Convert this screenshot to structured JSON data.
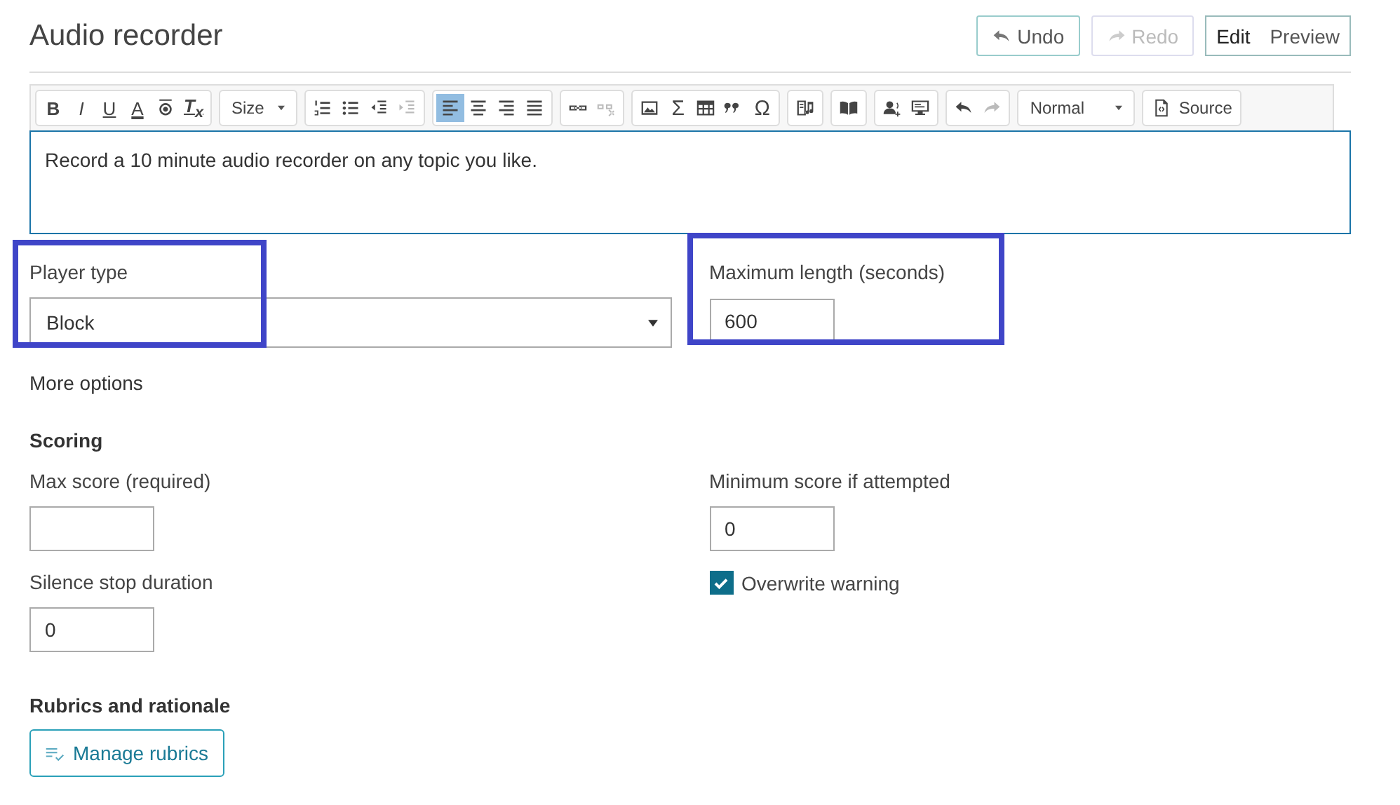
{
  "header": {
    "title": "Audio recorder",
    "undo": {
      "label": "Undo",
      "disabled": false
    },
    "redo": {
      "label": "Redo",
      "disabled": true
    },
    "modes": [
      {
        "label": "Edit",
        "selected": true
      },
      {
        "label": "Preview",
        "selected": false
      }
    ]
  },
  "toolbar": {
    "groups": [
      [
        {
          "kind": "text",
          "label": "B",
          "disabled": false,
          "active": false
        },
        {
          "kind": "text",
          "label": "I",
          "disabled": false,
          "active": false
        },
        {
          "kind": "text",
          "label": "U",
          "disabled": false,
          "active": false
        },
        {
          "kind": "text",
          "label": "A",
          "disabled": false,
          "active": false
        },
        {
          "kind": "format-circle",
          "disabled": false,
          "active": false
        },
        {
          "kind": "text",
          "label": "T$_{x}$",
          "disabled": false,
          "active": false
        }
      ],
      [
        {
          "kind": "dropdown",
          "label": "Size",
          "disabled": false,
          "active": false
        }
      ],
      [
        {
          "kind": "numbered-list",
          "disabled": false,
          "active": false
        },
        {
          "kind": "bullet-list",
          "disabled": false,
          "active": false
        },
        {
          "kind": "outdent",
          "disabled": false,
          "active": false
        },
        {
          "kind": "indent",
          "disabled": true,
          "active": false
        }
      ],
      [
        {
          "kind": "align-left",
          "disabled": false,
          "active": true
        },
        {
          "kind": "align-center",
          "disabled": false,
          "active": false
        },
        {
          "kind": "align-right",
          "disabled": false,
          "active": false
        },
        {
          "kind": "justify",
          "disabled": false,
          "active": false
        }
      ],
      [
        {
          "kind": "link",
          "disabled": false,
          "active": false
        },
        {
          "kind": "unlink",
          "disabled": true,
          "active": false
        }
      ],
      [
        {
          "kind": "image",
          "disabled": false,
          "active": false
        },
        {
          "kind": "text",
          "label": "Σ",
          "disabled": false,
          "active": false
        },
        {
          "kind": "table",
          "disabled": false,
          "active": false
        },
        {
          "kind": "quote",
          "disabled": false,
          "active": false
        },
        {
          "kind": "text",
          "label": "Ω",
          "disabled": false,
          "active": false
        }
      ],
      [
        {
          "kind": "audio",
          "disabled": false,
          "active": false
        }
      ],
      [
        {
          "kind": "book",
          "disabled": false,
          "active": false
        }
      ],
      [
        {
          "kind": "user-voice",
          "disabled": false,
          "active": false
        },
        {
          "kind": "screen",
          "disabled": false,
          "active": false
        }
      ],
      [
        {
          "kind": "undo",
          "disabled": false,
          "active": false
        },
        {
          "kind": "redo",
          "disabled": true,
          "active": false
        }
      ],
      [
        {
          "kind": "dropdown",
          "label": "Normal",
          "disabled": false,
          "active": false
        }
      ],
      [
        {
          "kind": "source",
          "label": "Source",
          "disabled": false,
          "active": false
        }
      ]
    ]
  },
  "editor": {
    "text": "Record a 10 minute audio recorder on any topic you like."
  },
  "player_type": {
    "label": "Player type",
    "value": "Block",
    "highlighted": true
  },
  "max_length": {
    "label": "Maximum length (seconds)",
    "value": "600",
    "highlighted": true
  },
  "more_options": "More options",
  "scoring": {
    "heading": "Scoring",
    "max_score": {
      "label": "Max score (required)"
    },
    "min_score": {
      "label": "Minimum score if attempted",
      "value": "0"
    },
    "silence": {
      "label": "Silence stop duration",
      "value": "0"
    },
    "overwrite": {
      "label": "Overwrite warning",
      "checked": true
    }
  },
  "rubrics": {
    "heading": "Rubrics and rationale",
    "button": "Manage rubrics"
  }
}
